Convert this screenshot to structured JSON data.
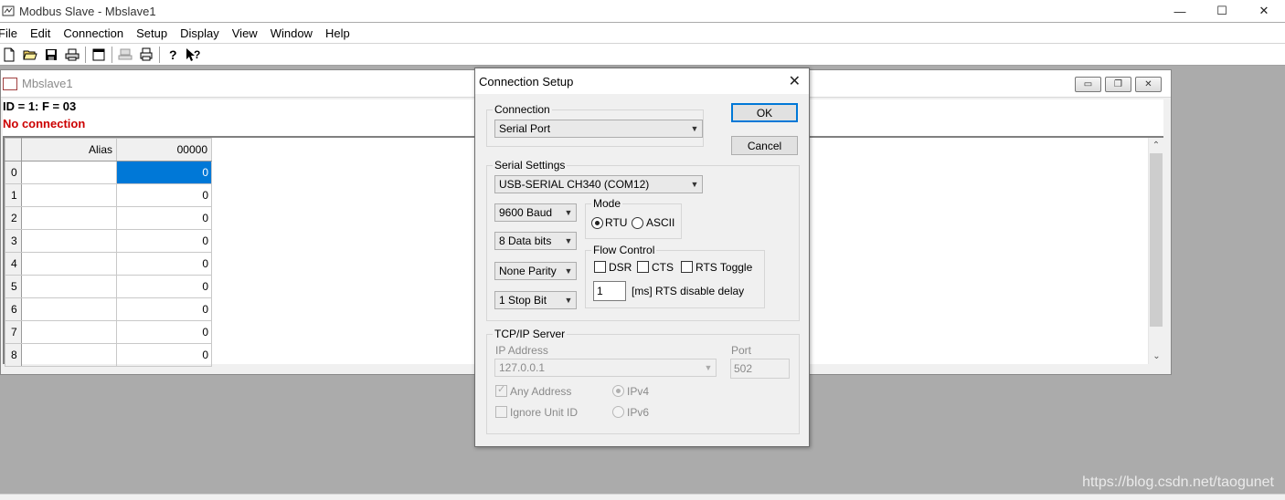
{
  "app": {
    "title": "Modbus Slave - Mbslave1",
    "window_controls": {
      "minimize": "—",
      "maximize": "☐",
      "close": "✕"
    }
  },
  "menu": [
    "File",
    "Edit",
    "Connection",
    "Setup",
    "Display",
    "View",
    "Window",
    "Help"
  ],
  "toolbar": {
    "icons": [
      "new-icon",
      "open-icon",
      "save-icon",
      "print-icon",
      "window-icon",
      "connect-icon",
      "printer-icon",
      "help-icon",
      "context-help-icon"
    ]
  },
  "child_window": {
    "title": "Mbslave1",
    "id_line": "ID = 1: F = 03",
    "status": "No connection",
    "status_color": "#cc0000",
    "controls": {
      "minimize": "▭",
      "restore": "❐",
      "close": "✕"
    },
    "grid": {
      "headers": [
        "Alias",
        "00000"
      ],
      "rows": [
        {
          "num": "0",
          "alias": "",
          "value": "0",
          "selected": true
        },
        {
          "num": "1",
          "alias": "",
          "value": "0"
        },
        {
          "num": "2",
          "alias": "",
          "value": "0"
        },
        {
          "num": "3",
          "alias": "",
          "value": "0"
        },
        {
          "num": "4",
          "alias": "",
          "value": "0"
        },
        {
          "num": "5",
          "alias": "",
          "value": "0"
        },
        {
          "num": "6",
          "alias": "",
          "value": "0"
        },
        {
          "num": "7",
          "alias": "",
          "value": "0"
        },
        {
          "num": "8",
          "alias": "",
          "value": "0"
        }
      ]
    }
  },
  "dialog": {
    "title": "Connection Setup",
    "close": "✕",
    "ok_label": "OK",
    "cancel_label": "Cancel",
    "connection": {
      "legend": "Connection",
      "value": "Serial Port"
    },
    "serial": {
      "legend": "Serial Settings",
      "port": "USB-SERIAL CH340 (COM12)",
      "baud": "9600 Baud",
      "data_bits": "8 Data bits",
      "parity": "None Parity",
      "stop_bits": "1 Stop Bit",
      "mode": {
        "legend": "Mode",
        "rtu": "RTU",
        "ascii": "ASCII",
        "selected": "RTU"
      },
      "flow": {
        "legend": "Flow Control",
        "dsr": "DSR",
        "cts": "CTS",
        "rts_toggle": "RTS Toggle",
        "delay_value": "1",
        "delay_label": "[ms] RTS disable delay"
      }
    },
    "tcp": {
      "legend": "TCP/IP Server",
      "ip_label": "IP Address",
      "ip_value": "127.0.0.1",
      "port_label": "Port",
      "port_value": "502",
      "any_address": "Any Address",
      "ignore_unit_id": "Ignore Unit ID",
      "ipv4": "IPv4",
      "ipv6": "IPv6"
    }
  },
  "watermark": "https://blog.csdn.net/taogunet"
}
